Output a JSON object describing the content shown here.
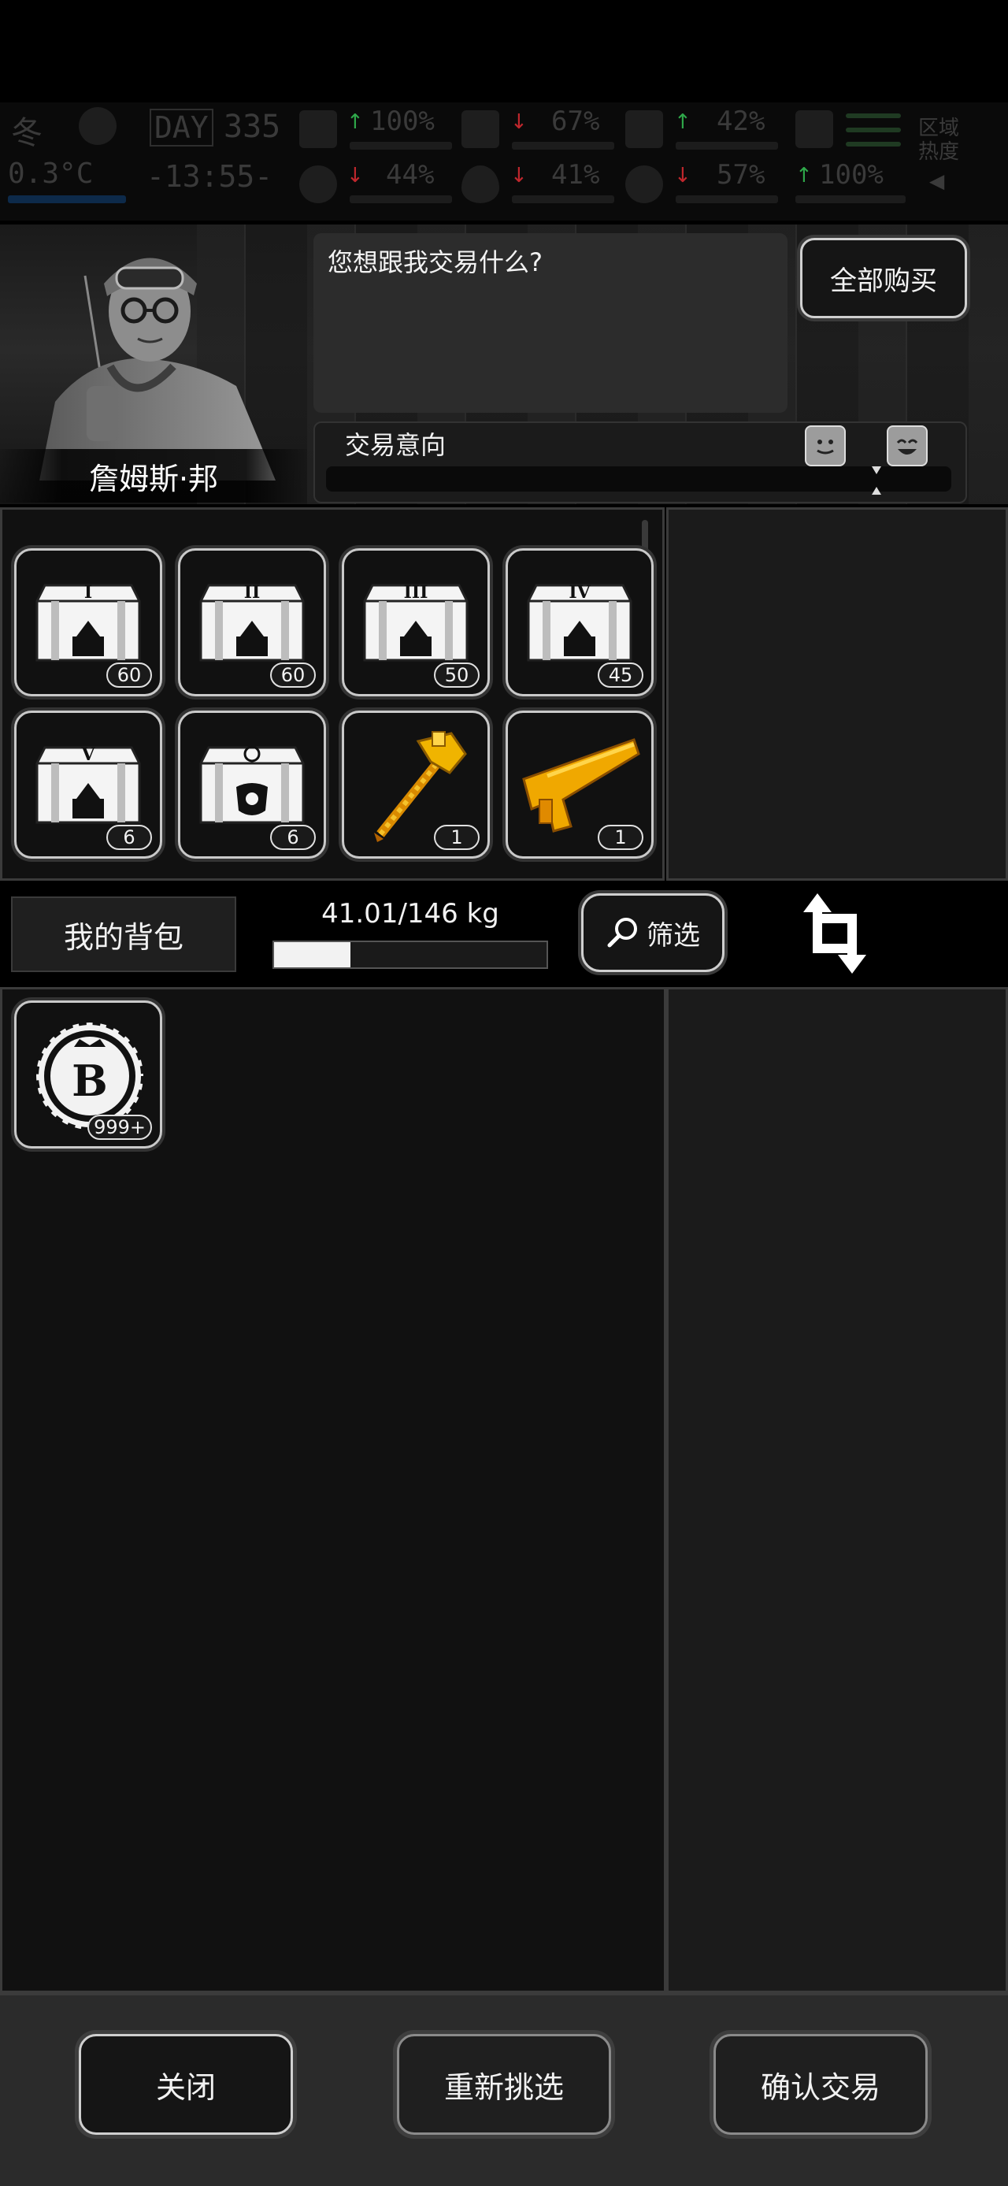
{
  "hud": {
    "season_glyph": "冬",
    "day_label": "DAY",
    "day": "335",
    "temperature": "0.3°C",
    "clock": "-13:55-",
    "stats": [
      {
        "name": "health",
        "value": "100%",
        "trend": "up"
      },
      {
        "name": "hunger",
        "value": "67%",
        "trend": "down"
      },
      {
        "name": "stamina",
        "value": "42%",
        "trend": "up"
      },
      {
        "name": "mood",
        "value": "44%",
        "trend": "down"
      },
      {
        "name": "thirst",
        "value": "41%",
        "trend": "down"
      },
      {
        "name": "heart",
        "value": "57%",
        "trend": "down"
      },
      {
        "name": "energy",
        "value": "100%",
        "trend": "up"
      }
    ],
    "region_label": "区域热度"
  },
  "trader": {
    "name": "詹姆斯·邦",
    "dialog": "您想跟我交易什么?",
    "buy_all_label": "全部购买",
    "intent_label": "交易意向",
    "intent_level": 0.88
  },
  "trader_items": [
    {
      "name": "supply-crate-I",
      "icon": "crate",
      "numeral": "I",
      "count": "60"
    },
    {
      "name": "supply-crate-II",
      "icon": "crate",
      "numeral": "II",
      "count": "60"
    },
    {
      "name": "supply-crate-III",
      "icon": "crate",
      "numeral": "III",
      "count": "50"
    },
    {
      "name": "supply-crate-IV",
      "icon": "crate",
      "numeral": "IV",
      "count": "45"
    },
    {
      "name": "supply-crate-V",
      "icon": "crate",
      "numeral": "V",
      "count": "6"
    },
    {
      "name": "special-crate",
      "icon": "crate",
      "numeral": "",
      "count": "6"
    },
    {
      "name": "golden-hammer",
      "icon": "hammer",
      "numeral": "",
      "count": "1"
    },
    {
      "name": "golden-rifle",
      "icon": "rifle",
      "numeral": "",
      "count": "1"
    }
  ],
  "bag": {
    "label": "我的背包",
    "weight_text": "41.01/146 kg",
    "weight_fraction": 0.281,
    "filter_label": "筛选",
    "items": [
      {
        "name": "bitcoin-token",
        "glyph": "B",
        "count": "999+"
      }
    ]
  },
  "footer": {
    "close_label": "关闭",
    "reselect_label": "重新挑选",
    "confirm_label": "确认交易"
  },
  "colors": {
    "background": "#000000",
    "panel": "#111111",
    "gold_item": "#f0b400",
    "stat_up": "#2fa84a",
    "stat_down": "#c0272d"
  }
}
